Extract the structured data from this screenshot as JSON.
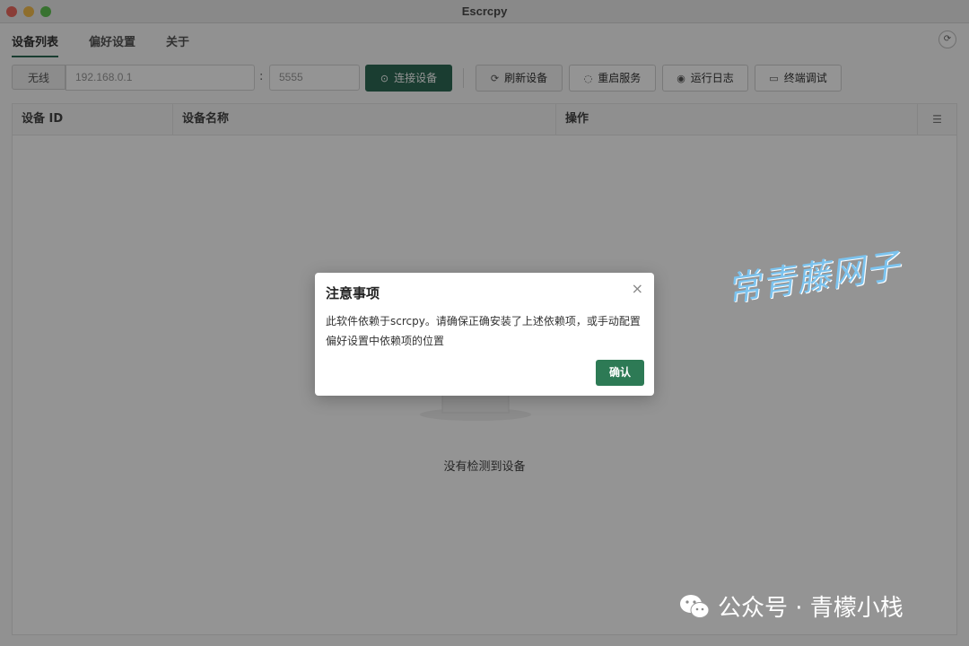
{
  "window": {
    "title": "Escrcpy"
  },
  "tabs": [
    {
      "label": "设备列表",
      "active": true
    },
    {
      "label": "偏好设置",
      "active": false
    },
    {
      "label": "关于",
      "active": false
    }
  ],
  "help_icon": "refresh-circle-icon",
  "toolbar": {
    "addon_label": "无线",
    "ip_placeholder": "192.168.0.1",
    "colon": ":",
    "port_placeholder": "5555",
    "connect_label": "连接设备",
    "refresh_label": "刷新设备",
    "restart_label": "重启服务",
    "log_label": "运行日志",
    "terminal_label": "终端调试"
  },
  "table": {
    "headers": [
      "设备 ID",
      "设备名称",
      "操作"
    ],
    "empty_text": "没有检测到设备"
  },
  "dialog": {
    "title": "注意事项",
    "close": "×",
    "body": "此软件依赖于scrcpy。请确保正确安装了上述依赖项，或手动配置偏好设置中依赖项的位置",
    "confirm_label": "确认"
  },
  "watermarks": {
    "main": "常青藤网子",
    "footer": "公众号 · 青檬小栈"
  },
  "colors": {
    "accent": "#2d6a55",
    "overlay": "rgba(0,0,0,0.42)"
  }
}
